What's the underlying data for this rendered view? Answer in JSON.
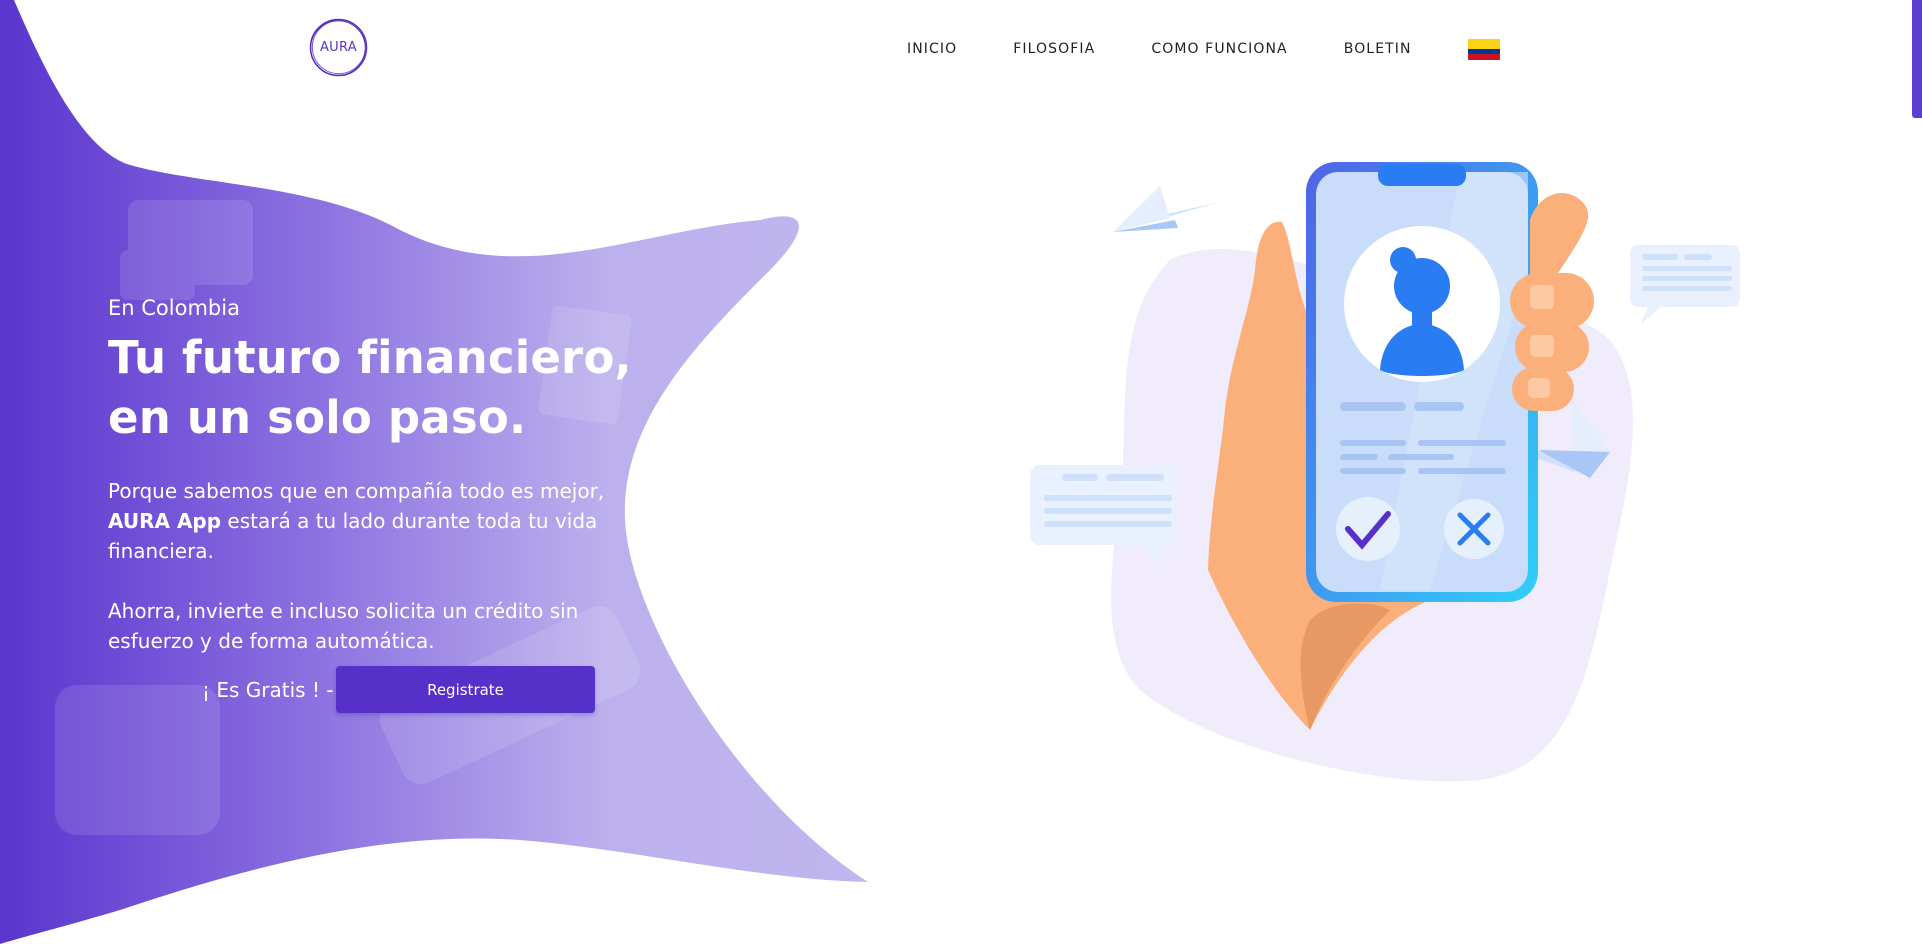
{
  "brand": {
    "logo_text": "AURA"
  },
  "nav": {
    "items": [
      "INICIO",
      "FILOSOFIA",
      "COMO FUNCIONA",
      "BOLETIN"
    ],
    "flag_icon": "colombia-flag-icon"
  },
  "hero": {
    "eyebrow": "En Colombia",
    "headline_line1": "Tu futuro financiero,",
    "headline_line2": "en un solo paso.",
    "paragraph1_before": "Porque sabemos que en compañía todo es mejor, ",
    "paragraph1_bold": "AURA App",
    "paragraph1_after": " estará a tu lado durante toda tu vida financiera.",
    "paragraph2": "Ahorra, invierte e incluso solicita un crédito sin esfuerzo y de forma automática.",
    "cta_label": "¡ Es Gratis !  -",
    "register_button": "Registrate"
  },
  "colors": {
    "accent": "#5530c9",
    "brand_purple": "#5b33c4",
    "blob_light": "#bdb3ec",
    "phone_blue": "#2a7cf3",
    "hand_skin": "#fbb07c",
    "flag_yellow": "#fcd116",
    "flag_blue": "#003893",
    "flag_red": "#ce1126"
  },
  "icons": [
    "paper-plane-icon",
    "chat-bubble-icon",
    "user-avatar-icon",
    "check-icon",
    "close-icon"
  ]
}
